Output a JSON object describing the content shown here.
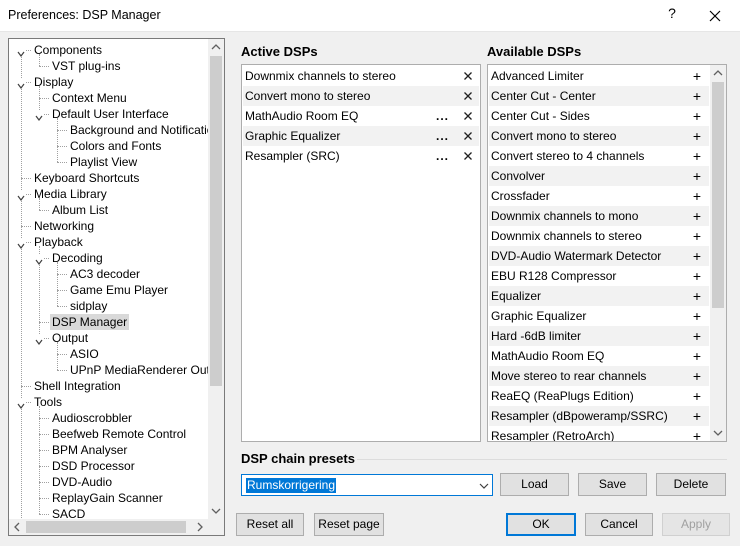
{
  "window": {
    "title": "Preferences: DSP Manager",
    "help_glyph": "?"
  },
  "tree": {
    "items": [
      {
        "label": "Components"
      },
      {
        "label": "VST plug-ins"
      },
      {
        "label": "Display"
      },
      {
        "label": "Context Menu"
      },
      {
        "label": "Default User Interface"
      },
      {
        "label": "Background and Notifications"
      },
      {
        "label": "Colors and Fonts"
      },
      {
        "label": "Playlist View"
      },
      {
        "label": "Keyboard Shortcuts"
      },
      {
        "label": "Media Library"
      },
      {
        "label": "Album List"
      },
      {
        "label": "Networking"
      },
      {
        "label": "Playback"
      },
      {
        "label": "Decoding"
      },
      {
        "label": "AC3 decoder"
      },
      {
        "label": "Game Emu Player"
      },
      {
        "label": "sidplay"
      },
      {
        "label": "DSP Manager"
      },
      {
        "label": "Output"
      },
      {
        "label": "ASIO"
      },
      {
        "label": "UPnP MediaRenderer Output"
      },
      {
        "label": "Shell Integration"
      },
      {
        "label": "Tools"
      },
      {
        "label": "Audioscrobbler"
      },
      {
        "label": "Beefweb Remote Control"
      },
      {
        "label": "BPM Analyser"
      },
      {
        "label": "DSD Processor"
      },
      {
        "label": "DVD-Audio"
      },
      {
        "label": "ReplayGain Scanner"
      },
      {
        "label": "SACD"
      }
    ],
    "selected": "DSP Manager"
  },
  "active_dsps": {
    "header": "Active DSPs",
    "items": [
      {
        "label": "Downmix channels to stereo",
        "configurable": false
      },
      {
        "label": "Convert mono to stereo",
        "configurable": false
      },
      {
        "label": "MathAudio Room EQ",
        "configurable": true
      },
      {
        "label": "Graphic Equalizer",
        "configurable": true
      },
      {
        "label": "Resampler (SRC)",
        "configurable": true
      }
    ],
    "config_glyph": "...",
    "remove_glyph": "×"
  },
  "available_dsps": {
    "header": "Available DSPs",
    "add_glyph": "+",
    "items": [
      "Advanced Limiter",
      "Center Cut - Center",
      "Center Cut - Sides",
      "Convert mono to stereo",
      "Convert stereo to 4 channels",
      "Convolver",
      "Crossfader",
      "Downmix channels to mono",
      "Downmix channels to stereo",
      "DVD-Audio Watermark Detector",
      "EBU R128 Compressor",
      "Equalizer",
      "Graphic Equalizer",
      "Hard -6dB limiter",
      "MathAudio Room EQ",
      "Move stereo to rear channels",
      "ReaEQ (ReaPlugs Edition)",
      "Resampler (dBpoweramp/SSRC)",
      "Resampler (RetroArch)"
    ]
  },
  "presets": {
    "header": "DSP chain presets",
    "selected": "Rumskorrigering",
    "load_label": "Load",
    "save_label": "Save",
    "delete_label": "Delete"
  },
  "footer": {
    "reset_all_label": "Reset all",
    "reset_page_label": "Reset page",
    "ok_label": "OK",
    "cancel_label": "Cancel",
    "apply_label": "Apply"
  },
  "colors": {
    "accent": "#0078d7",
    "selection_bg": "#d9d9d9",
    "row_alt": "#f2f2f2"
  }
}
